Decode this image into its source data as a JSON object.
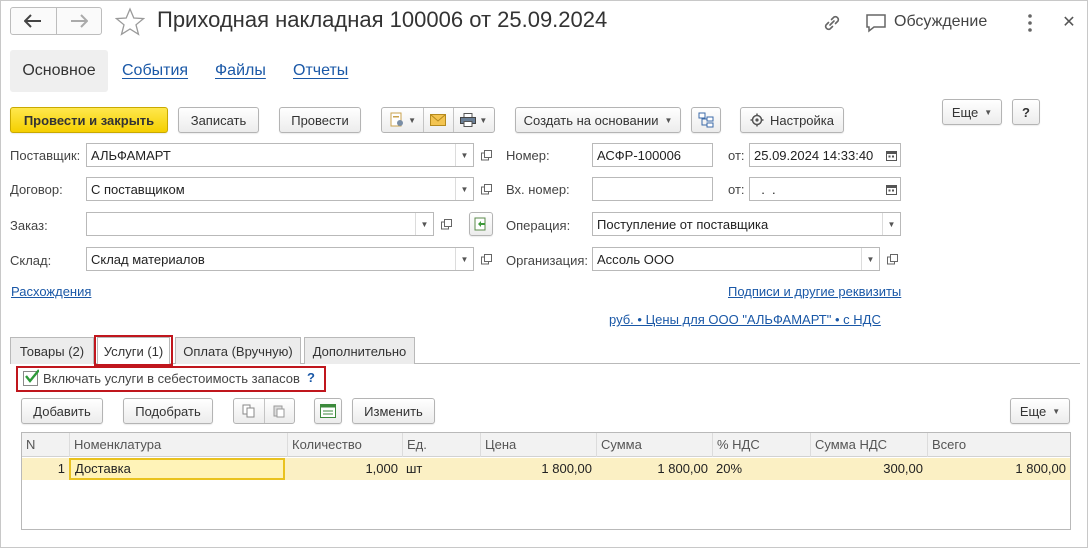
{
  "window": {
    "title": "Приходная накладная 100006 от 25.09.2024",
    "discussion_label": "Обсуждение"
  },
  "nav": {
    "tabs": [
      "Основное",
      "События",
      "Файлы",
      "Отчеты"
    ]
  },
  "toolbar": {
    "post_close": "Провести и закрыть",
    "save": "Записать",
    "post": "Провести",
    "create_based": "Создать на основании",
    "settings": "Настройка",
    "more": "Еще",
    "help": "?"
  },
  "form": {
    "supplier_label": "Поставщик:",
    "supplier_value": "АЛЬФАМАРТ",
    "contract_label": "Договор:",
    "contract_value": "С поставщиком",
    "order_label": "Заказ:",
    "order_value": "",
    "warehouse_label": "Склад:",
    "warehouse_value": "Склад материалов",
    "number_label": "Номер:",
    "number_value": "АСФР-100006",
    "date_label": "от:",
    "date_value": "25.09.2024 14:33:40",
    "in_number_label": "Вх. номер:",
    "in_number_value": "",
    "in_date_label": "от:",
    "in_date_value": "  .  .",
    "operation_label": "Операция:",
    "operation_value": "Поступление от поставщика",
    "organization_label": "Организация:",
    "organization_value": "Ассоль ООО",
    "discrepancies_link": "Расхождения",
    "signatures_link": "Подписи и другие реквизиты",
    "prices_link": "руб. • Цены для ООО \"АЛЬФАМАРТ\" • с НДС"
  },
  "tabs": [
    "Товары (2)",
    "Услуги (1)",
    "Оплата (Вручную)",
    "Дополнительно"
  ],
  "services": {
    "include_cost_label": "Включать услуги в себестоимость запасов",
    "include_cost_checked": true,
    "help": "?",
    "add": "Добавить",
    "pick": "Подобрать",
    "change": "Изменить",
    "more": "Еще",
    "columns": [
      "N",
      "Номенклатура",
      "Количество",
      "Ед.",
      "Цена",
      "Сумма",
      "% НДС",
      "Сумма НДС",
      "Всего"
    ],
    "rows": [
      {
        "n": "1",
        "item": "Доставка",
        "qty": "1,000",
        "unit": "шт",
        "price": "1 800,00",
        "sum": "1 800,00",
        "vat_rate": "20%",
        "vat_sum": "300,00",
        "total": "1 800,00"
      }
    ]
  },
  "colors": {
    "primary_button": "#f5cf00",
    "link": "#1a58a7",
    "highlight_box": "#c0161d",
    "selected_row": "#fbf0c4",
    "checkmark": "#2e9a3a"
  }
}
